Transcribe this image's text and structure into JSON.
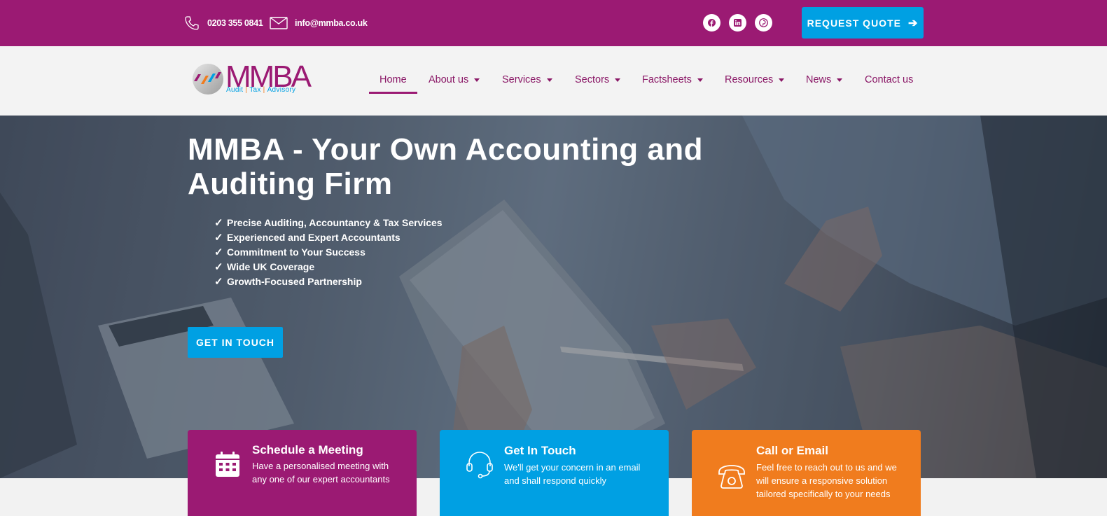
{
  "topbar": {
    "phone": "0203 355 0841",
    "email": "info@mmba.co.uk",
    "social": [
      "facebook-icon",
      "linkedin-icon",
      "pinterest-icon"
    ],
    "quote_label": "REQUEST QUOTE",
    "bg_color": "#9b1a73"
  },
  "logo": {
    "word": "MMBA",
    "tagline": [
      "Audit",
      "Tax",
      "Advisory"
    ]
  },
  "nav": {
    "items": [
      {
        "label": "Home",
        "active": true
      },
      {
        "label": "About us",
        "dropdown": true
      },
      {
        "label": "Services",
        "dropdown": true
      },
      {
        "label": "Sectors",
        "dropdown": true
      },
      {
        "label": "Factsheets",
        "dropdown": true
      },
      {
        "label": "Resources",
        "dropdown": true
      },
      {
        "label": "News",
        "dropdown": true
      },
      {
        "label": "Contact us"
      }
    ]
  },
  "hero": {
    "title": "MMBA - Your Own Accounting and Auditing Firm",
    "bullets": [
      "Precise Auditing, Accountancy & Tax Services",
      "Experienced and Expert Accountants",
      "Commitment to Your Success",
      "Wide UK Coverage",
      "Growth-Focused Partnership"
    ],
    "cta_label": "GET IN TOUCH"
  },
  "cards": [
    {
      "title": "Schedule a Meeting",
      "text": "Have a personalised meeting with any one of our expert accountants",
      "icon": "calendar-icon",
      "color": "#9b1a73"
    },
    {
      "title": "Get In Touch",
      "text": "We'll get your concern in an email and shall respond quickly",
      "icon": "headset-icon",
      "color": "#00a0e3"
    },
    {
      "title": "Call or Email",
      "text": "Feel free to reach out to us and we will ensure a responsive solution tailored specifically to your needs",
      "icon": "telephone-icon",
      "color": "#f07c1e"
    }
  ],
  "colors": {
    "brand_purple": "#9b1a73",
    "brand_blue": "#00a0e3",
    "brand_orange": "#f07c1e"
  }
}
